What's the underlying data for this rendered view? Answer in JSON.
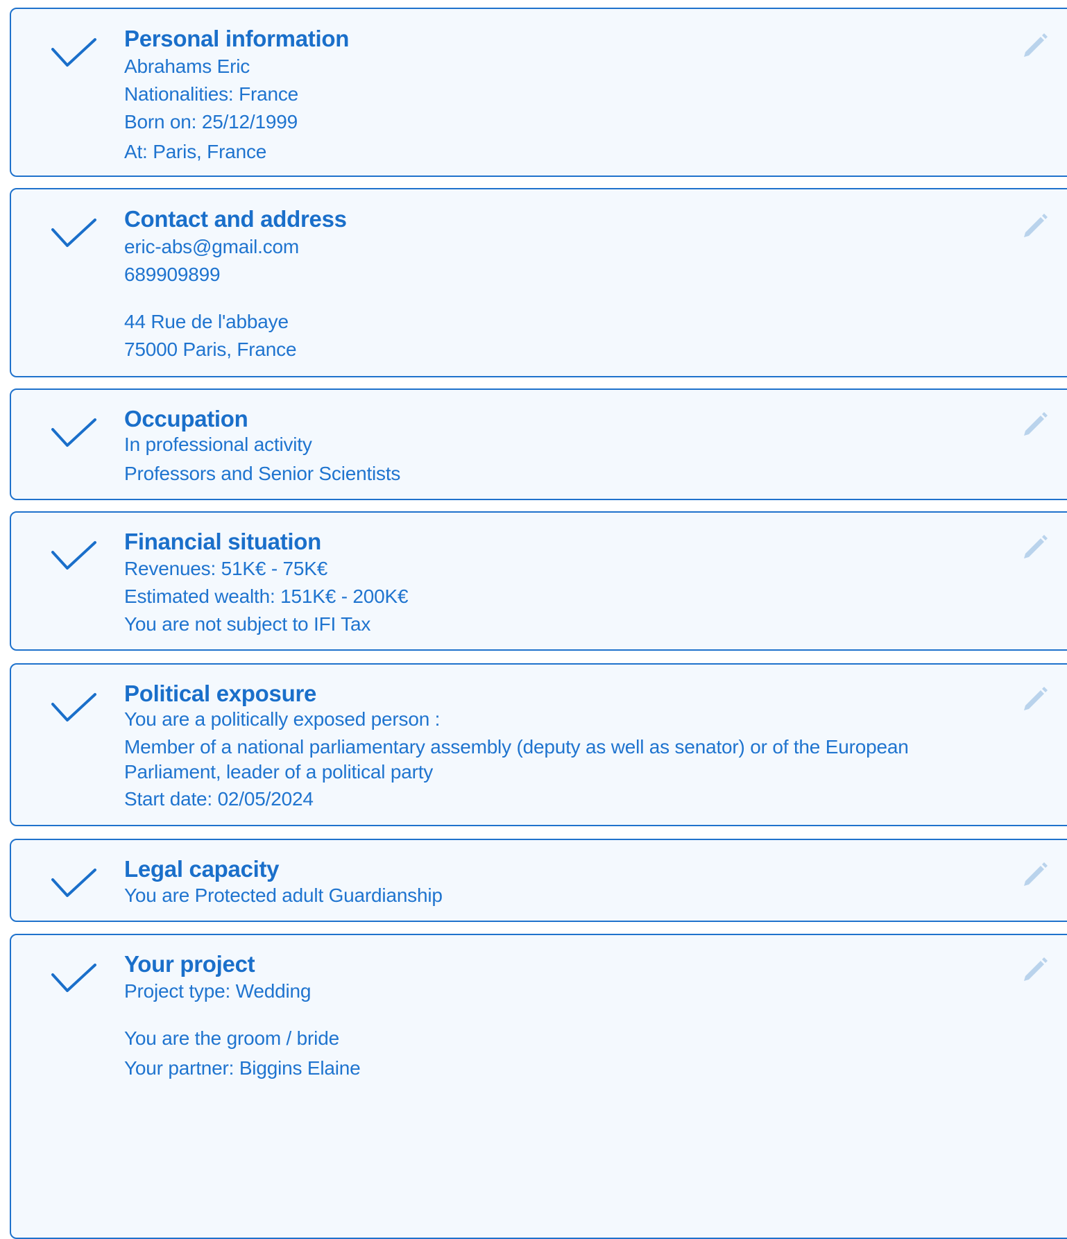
{
  "sections": {
    "personal": {
      "title": "Personal information",
      "name": "Abrahams Eric",
      "nationalities": "Nationalities: France",
      "born_on": "Born on: 25/12/1999",
      "born_at": "At: Paris, France"
    },
    "contact": {
      "title": "Contact and address",
      "email": "eric-abs@gmail.com",
      "phone": "689909899",
      "street": "44 Rue de l'abbaye",
      "city": "75000 Paris, France"
    },
    "occupation": {
      "title": "Occupation",
      "status": "In professional activity",
      "category": "Professors and Senior Scientists"
    },
    "financial": {
      "title": "Financial situation",
      "revenues": "Revenues: 51K€ - 75K€",
      "wealth": "Estimated wealth: 151K€ - 200K€",
      "ifi": "You are not subject to IFI Tax"
    },
    "political": {
      "title": "Political exposure",
      "exposed": "You are a politically exposed person :",
      "role_line1": "Member of a national parliamentary assembly (deputy as well as senator) or of the European",
      "role_line2": "Parliament, leader of a political party",
      "start_date": "Start date: 02/05/2024"
    },
    "legal": {
      "title": "Legal capacity",
      "status": "You are Protected adult Guardianship"
    },
    "project": {
      "title": "Your project",
      "type": "Project type: Wedding",
      "role": "You are the groom / bride",
      "partner": "Your partner: Biggins Elaine"
    }
  },
  "icons": {
    "status": "check-icon",
    "action": "pencil-icon"
  },
  "colors": {
    "accent": "#1a6fca",
    "text": "#1f74cf",
    "border": "#1f72cc",
    "card_background": "#f4f9fe",
    "edit_icon": "#b9d3ec"
  }
}
